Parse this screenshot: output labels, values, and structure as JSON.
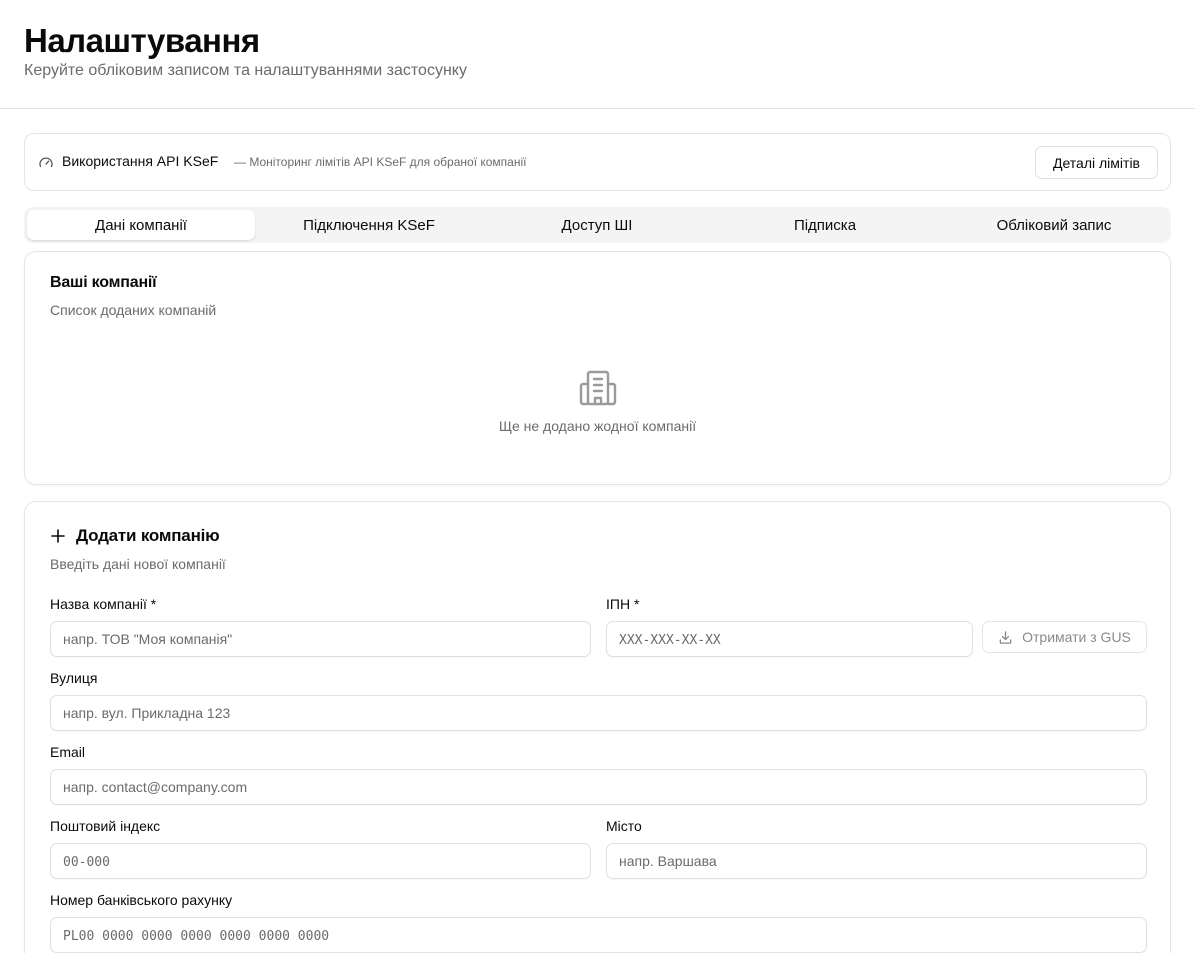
{
  "header": {
    "title": "Налаштування",
    "subtitle": "Керуйте обліковим записом та налаштуваннями застосунку"
  },
  "api_usage": {
    "icon": "gauge-icon",
    "title": "Використання API KSeF",
    "description": "— Моніторинг лімітів API KSeF для обраної компанії",
    "details_button": "Деталі лімітів"
  },
  "tabs": [
    {
      "label": "Дані компанії",
      "active": true
    },
    {
      "label": "Підключення KSeF",
      "active": false
    },
    {
      "label": "Доступ ШІ",
      "active": false
    },
    {
      "label": "Підписка",
      "active": false
    },
    {
      "label": "Обліковий запис",
      "active": false
    }
  ],
  "companies": {
    "title": "Ваші компанії",
    "description": "Список доданих компаній",
    "empty_icon": "building-icon",
    "empty_text": "Ще не додано жодної компанії"
  },
  "add_company": {
    "icon": "plus-icon",
    "title": "Додати компанію",
    "description": "Введіть дані нової компанії",
    "fields": {
      "name": {
        "label": "Назва компанії *",
        "placeholder": "напр. ТОВ \"Моя компанія\""
      },
      "tax_id": {
        "label": "ІПН *",
        "placeholder": "XXX-XXX-XX-XX"
      },
      "street": {
        "label": "Вулиця",
        "placeholder": "напр. вул. Прикладна 123"
      },
      "email": {
        "label": "Email",
        "placeholder": "напр. contact@company.com"
      },
      "postal_code": {
        "label": "Поштовий індекс",
        "placeholder": "00-000"
      },
      "city": {
        "label": "Місто",
        "placeholder": "напр. Варшава"
      },
      "bank_account": {
        "label": "Номер банківського рахунку",
        "placeholder": "PL00 0000 0000 0000 0000 0000 0000"
      }
    },
    "gus_button": {
      "icon": "download-icon",
      "label": "Отримати з GUS"
    }
  }
}
